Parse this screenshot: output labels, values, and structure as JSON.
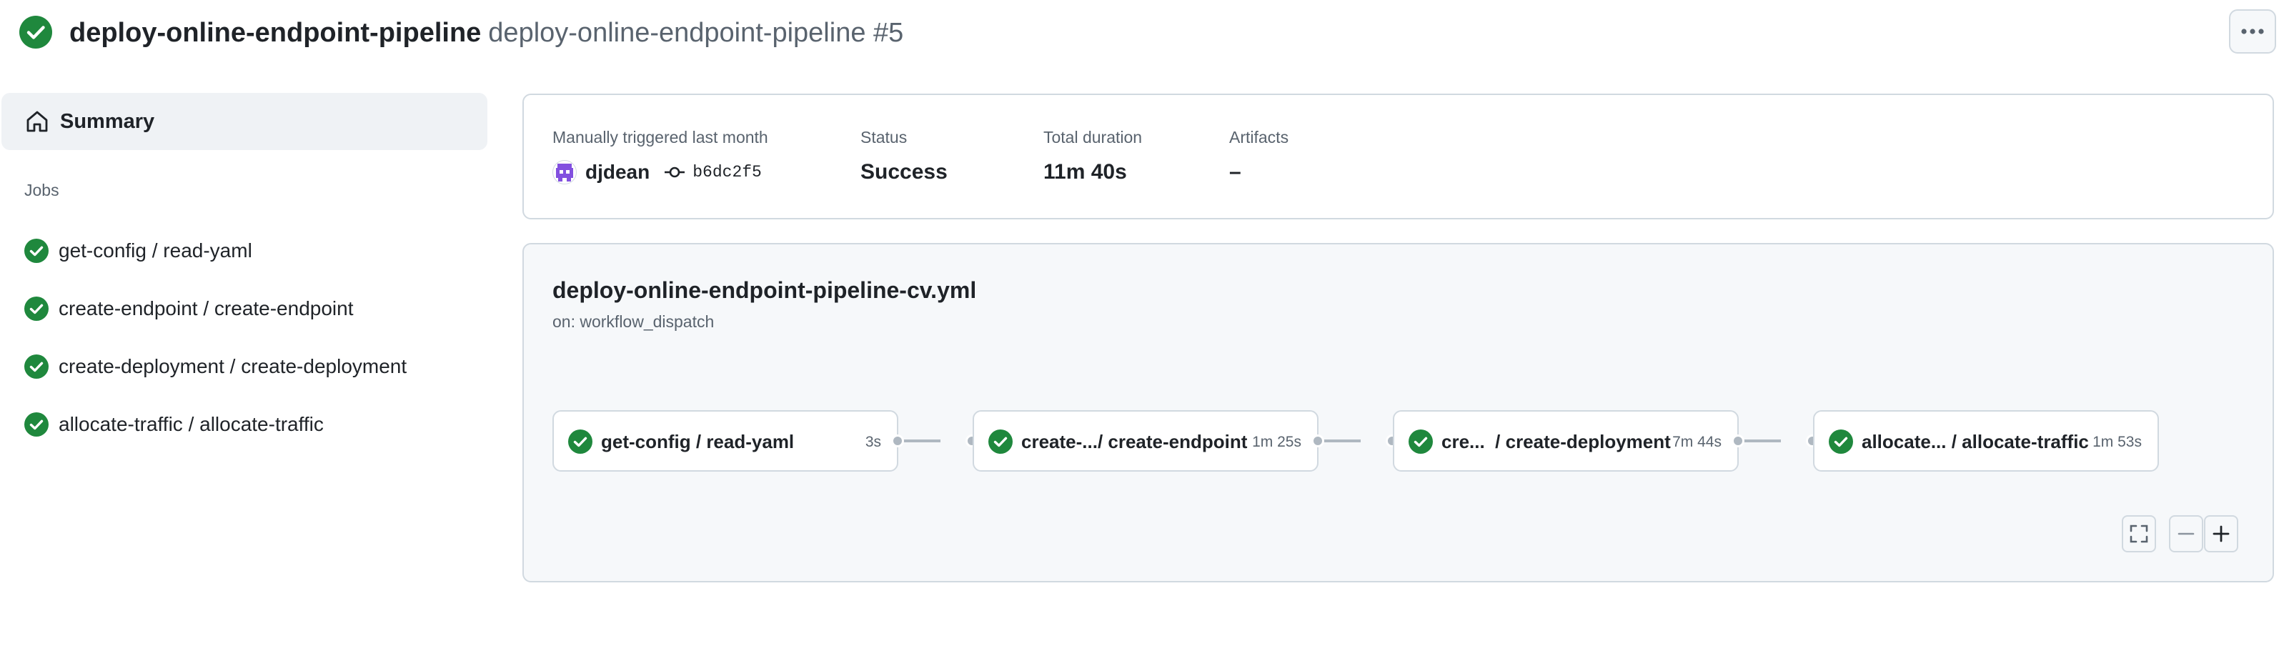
{
  "header": {
    "workflow_name": "deploy-online-endpoint-pipeline",
    "run_title": "deploy-online-endpoint-pipeline #5",
    "status_icon": "check-circle-fill-icon",
    "more_icon": "kebab-horizontal-icon"
  },
  "sidebar": {
    "summary_label": "Summary",
    "jobs_heading": "Jobs",
    "jobs": [
      {
        "label": "get-config / read-yaml"
      },
      {
        "label": "create-endpoint / create-endpoint"
      },
      {
        "label": "create-deployment / create-deployment"
      },
      {
        "label": "allocate-traffic / allocate-traffic"
      }
    ]
  },
  "summary": {
    "trigger_label": "Manually triggered last month",
    "actor": "djdean",
    "commit": "b6dc2f5",
    "status_label": "Status",
    "status_value": "Success",
    "duration_label": "Total duration",
    "duration_value": "11m 40s",
    "artifacts_label": "Artifacts",
    "artifacts_value": "–"
  },
  "graph": {
    "file": "deploy-online-endpoint-pipeline-cv.yml",
    "trigger": "on: workflow_dispatch",
    "nodes": [
      {
        "name": "get-config / read-yaml",
        "duration": "3s"
      },
      {
        "name": "create-.../ create-endpoint",
        "duration": "1m 25s"
      },
      {
        "name": "cre...  / create-deployment",
        "duration": "7m 44s"
      },
      {
        "name": "allocate... / allocate-traffic",
        "duration": "1m 53s"
      }
    ]
  },
  "colors": {
    "success": "#1f883d",
    "border": "#d1d9e0",
    "muted": "#59636e",
    "connector": "#afb8c1",
    "selected_bg": "#eff2f5",
    "avatar": "#8250df"
  }
}
